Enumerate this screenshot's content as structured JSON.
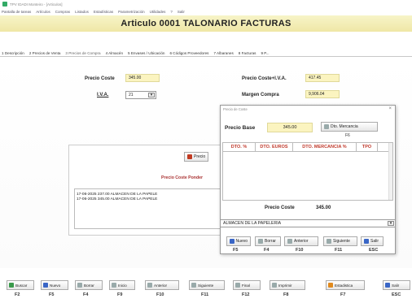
{
  "window": {
    "title": "TPV IDADI Monteiro - [Articulos]"
  },
  "menu": [
    "Pantalla de tareas",
    "Artículos",
    "Compras",
    "Listados",
    "Estadísticas",
    "Parametrización",
    "Utilidades",
    "?",
    "Salir"
  ],
  "form_title": "Articulo  0001  TALONARIO FACTURAS",
  "tabs": [
    "1 Descripción",
    "2 Precios de Venta",
    "3 Precios de Compra",
    "4 Almacén",
    "5 Envases / Ubicación",
    "6 Códigos Proveedores",
    "7 Albaranes",
    "8 Facturas",
    "9 P..."
  ],
  "fields": {
    "precio_coste_label": "Precio Coste",
    "precio_coste_value": "345.00",
    "iva_label": "I.V.A.",
    "iva_value": "21",
    "precio_coste_iva_label": "Precio Coste+I.V.A.",
    "precio_coste_iva_value": "417.45",
    "margen_compra_label": "Margen Compra",
    "margen_compra_value": "9,906.04"
  },
  "precio_button": "Precio",
  "ponderado_label": "Precio Coste Ponder",
  "history": [
    "17-06-2025      237.00 ALMACEN DE LA PAPELE",
    "17-06-2025      345.00 ALMACEN DE LA PAPELE"
  ],
  "dialog": {
    "title": "Precio de Coste",
    "close": "×",
    "precio_base_label": "Precio Base",
    "precio_base_value": "345.00",
    "dto_mercancia_button": "Dto. Mercancia",
    "dto_key": "F6",
    "grid_headers": [
      "DTO. %",
      "DTO. EUROS",
      "DTO. MERCANCIA %",
      "TPO"
    ],
    "precio_coste_label": "Precio Coste",
    "precio_coste_value": "345.00",
    "almacen_selected": "ALMACEN DE LA PAPELERIA",
    "buttons": [
      {
        "label": "Nuevo",
        "key": "F5",
        "icon": "new-icon"
      },
      {
        "label": "Borrar",
        "key": "F4",
        "icon": "delete-icon"
      },
      {
        "label": "Anterior",
        "key": "F10",
        "icon": "previous-icon"
      },
      {
        "label": "Siguiente",
        "key": "F11",
        "icon": "next-icon"
      },
      {
        "label": "Salir",
        "key": "ESC",
        "icon": "exit-icon"
      }
    ]
  },
  "footer_buttons": [
    {
      "label": "Buscar",
      "key": "F2",
      "icon": "search-icon"
    },
    {
      "label": "Nuevo",
      "key": "F5",
      "icon": "new-icon"
    },
    {
      "label": "Borrar",
      "key": "F4",
      "icon": "delete-icon"
    },
    {
      "label": "Inicio",
      "key": "F9",
      "icon": "home-icon"
    },
    {
      "label": "Anterior",
      "key": "F10",
      "icon": "previous-icon"
    },
    {
      "label": "Siguiente",
      "key": "F11",
      "icon": "next-icon"
    },
    {
      "label": "Final",
      "key": "F12",
      "icon": "last-icon"
    },
    {
      "label": "Imprimir",
      "key": "F8",
      "icon": "print-icon"
    },
    {
      "label": "Estadistica",
      "key": "F7",
      "icon": "stats-icon"
    },
    {
      "label": "Salir",
      "key": "ESC",
      "icon": "exit-icon"
    }
  ]
}
